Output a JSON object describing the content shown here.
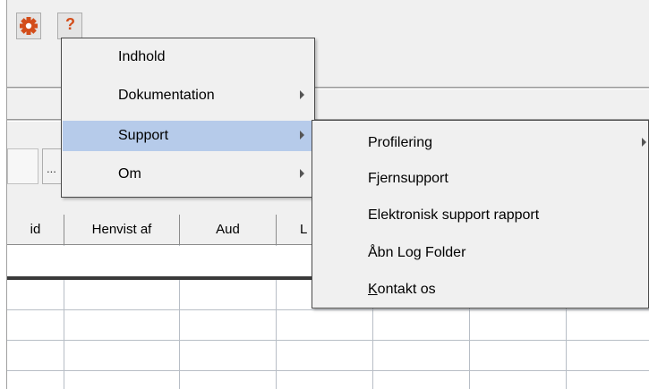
{
  "toolbar": {
    "gear_icon": "gear-icon",
    "help_label": "?",
    "colors": {
      "gear": "#d34d1a",
      "help": "#d34d1a"
    }
  },
  "ellipsis_label": "...",
  "grid": {
    "columns": [
      "id",
      "Henvist af",
      "Aud",
      "L"
    ]
  },
  "help_menu": {
    "items": [
      {
        "label": "Indhold",
        "submenu": false
      },
      {
        "label": "Dokumentation",
        "submenu": true
      },
      {
        "label": "Support",
        "submenu": true,
        "selected": true
      },
      {
        "label": "Om",
        "submenu": true
      }
    ]
  },
  "support_menu": {
    "items": [
      {
        "label": "Profilering",
        "submenu": true
      },
      {
        "label": "Fjernsupport",
        "submenu": false
      },
      {
        "label": "Elektronisk support rapport",
        "submenu": false
      },
      {
        "label": "Åbn Log Folder",
        "submenu": false
      },
      {
        "label_accel": "K",
        "label_rest": "ontakt os",
        "submenu": false
      }
    ]
  },
  "colors": {
    "menu_highlight": "#b6cbea",
    "background": "#f0f0f0"
  }
}
